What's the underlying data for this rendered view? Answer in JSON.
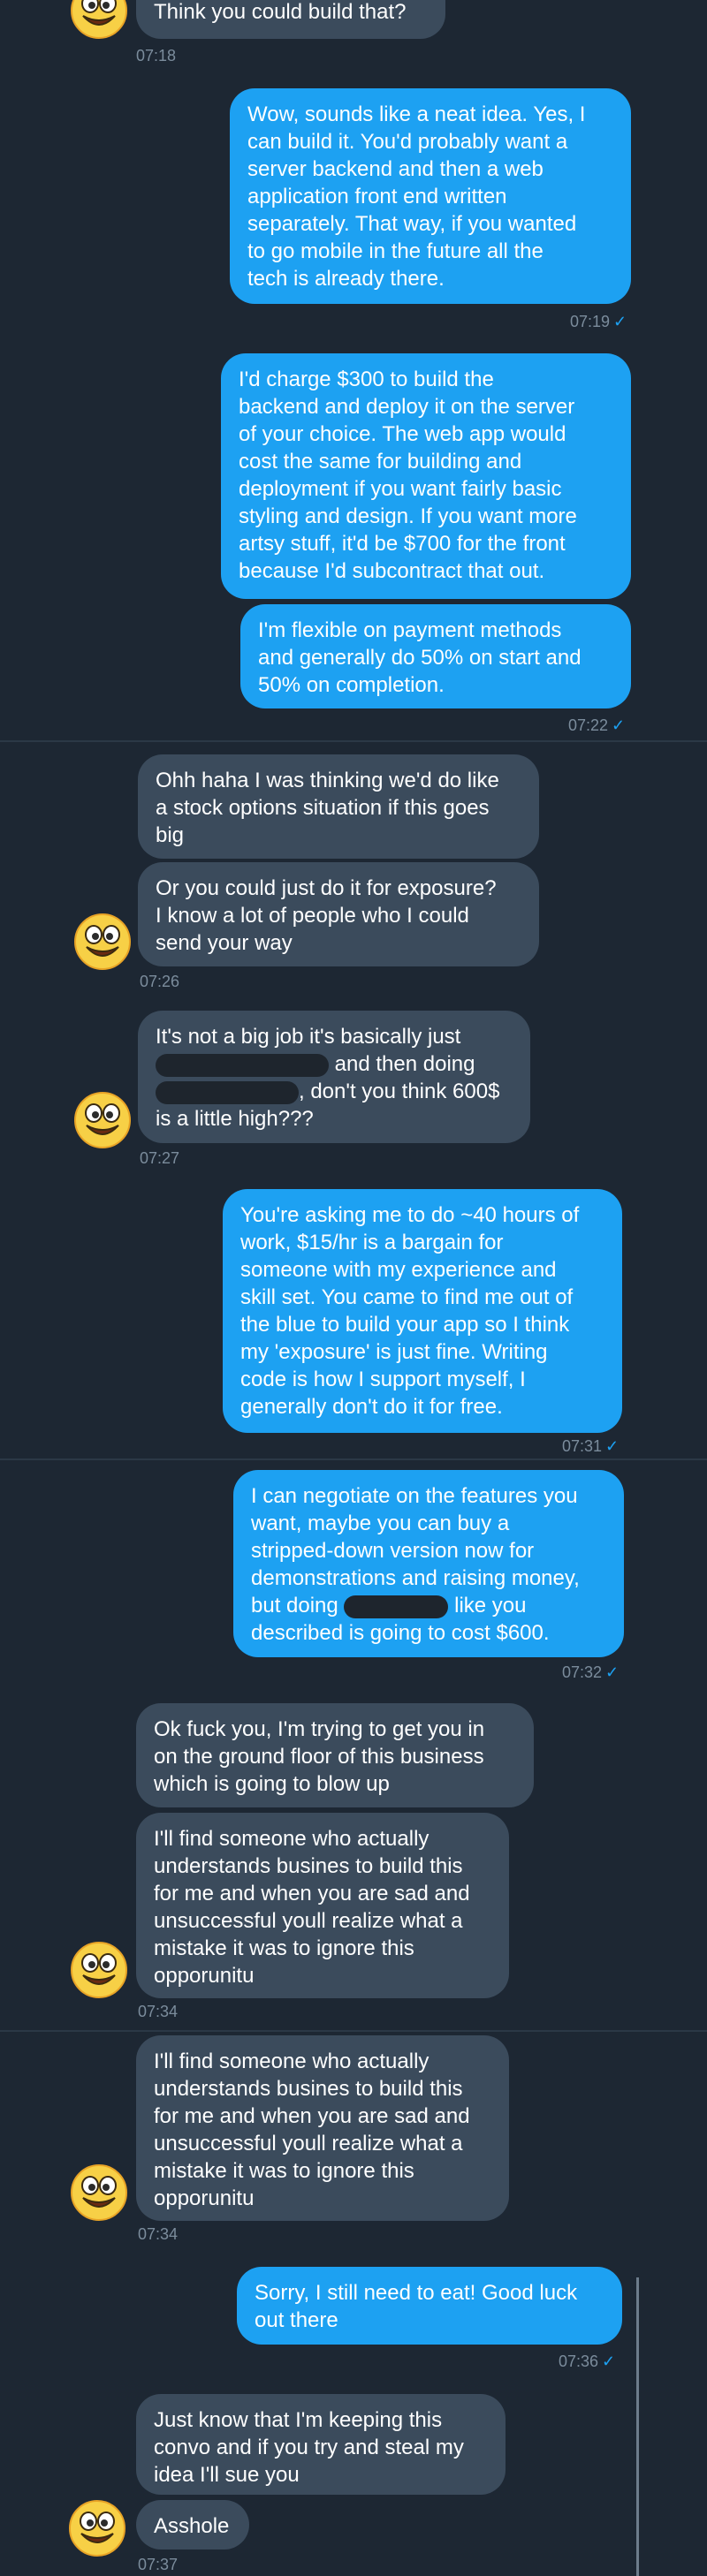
{
  "messages": {
    "m1": {
      "text": "Think you could build that?",
      "time": "07:18"
    },
    "m2": {
      "lines": [
        "Wow, sounds like a neat idea. Yes, I",
        "can build it. You'd probably want a",
        "server backend and then a web",
        "application front end written",
        "separately. That way, if you wanted",
        "to go mobile in the future all the",
        "tech is already there."
      ],
      "time": "07:19",
      "check": "✓"
    },
    "m3": {
      "lines": [
        "I'd charge $300 to build the",
        "backend and deploy it on the server",
        "of your choice. The web app would",
        "cost the same for building and",
        "deployment if you want fairly basic",
        "styling and design. If you want more",
        "artsy stuff, it'd be $700 for the front",
        "because I'd subcontract that out."
      ]
    },
    "m4": {
      "lines": [
        "I'm flexible on payment methods",
        "and generally do 50% on start and",
        "50% on completion."
      ],
      "time": "07:22",
      "check": "✓"
    },
    "m5": {
      "lines": [
        "Ohh haha I was thinking we'd do like",
        "a stock options situation if this goes",
        "big"
      ]
    },
    "m6": {
      "lines": [
        "Or you could just do it for exposure?",
        "I know a lot of people who I could",
        "send your way"
      ],
      "time": "07:26"
    },
    "m7": {
      "line1": "It's not a big job it's basically just",
      "line2": "and then doing",
      "line3": ", don't you think 600$",
      "line4": "is a little high???",
      "time": "07:27"
    },
    "m8": {
      "lines": [
        "You're asking me to do ~40 hours of",
        "work, $15/hr is a bargain for",
        "someone with my experience and",
        "skill set. You came to find me out of",
        "the blue to build your app so I think",
        "my 'exposure' is just fine. Writing",
        "code is how I support myself, I",
        "generally don't do it for free."
      ],
      "time": "07:31",
      "check": "✓"
    },
    "m9": {
      "line1": "I can negotiate on the features you",
      "line2": "want, maybe you can buy a",
      "line3": "stripped-down version now for",
      "line4": "demonstrations and raising money,",
      "line5a": "but doing",
      "line5b": "like you",
      "line6": "described is going to cost $600.",
      "time": "07:32",
      "check": "✓"
    },
    "m10": {
      "lines": [
        "Ok fuck you, I'm trying to get you in",
        "on the ground floor of this business",
        "which is going to blow up"
      ]
    },
    "m11": {
      "lines": [
        "I'll find someone who actually",
        "understands busines to build this",
        "for me and when you are sad and",
        "unsuccessful youll realize what a",
        "mistake it was to ignore this",
        "opporunitu"
      ],
      "time": "07:34"
    },
    "m12": {
      "lines": [
        "I'll find someone who actually",
        "understands busines to build this",
        "for me and when you are sad and",
        "unsuccessful youll realize what a",
        "mistake it was to ignore this",
        "opporunitu"
      ],
      "time": "07:34"
    },
    "m13": {
      "lines": [
        "Sorry, I still need to eat! Good luck",
        "out there"
      ],
      "time": "07:36",
      "check": "✓"
    },
    "m14": {
      "lines": [
        "Just know that I'm keeping this",
        "convo and if you try and steal my",
        "idea I'll sue you"
      ]
    },
    "m15": {
      "text": "Asshole",
      "time": "07:37"
    }
  },
  "avatar": {
    "icon": "smiley-face-icon",
    "face_color": "#f7d046",
    "outline_color": "#e8a326"
  }
}
